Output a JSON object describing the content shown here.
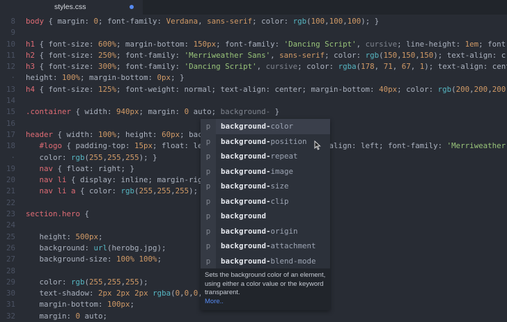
{
  "tab": {
    "title": "styles.css",
    "modified": true
  },
  "lines": [
    {
      "n": "8",
      "i": 0,
      "t": [
        [
          "s",
          "body"
        ],
        [
          "t",
          " { margin: "
        ],
        [
          "n",
          "0"
        ],
        [
          "t",
          "; font-family: "
        ],
        [
          "n",
          "Verdana"
        ],
        [
          "t",
          ", "
        ],
        [
          "n",
          "sans-serif"
        ],
        [
          "t",
          "; color: "
        ],
        [
          "f",
          "rgb"
        ],
        [
          "t",
          "("
        ],
        [
          "n",
          "100"
        ],
        [
          "t",
          ","
        ],
        [
          "n",
          "100"
        ],
        [
          "t",
          ","
        ],
        [
          "n",
          "100"
        ],
        [
          "t",
          "); }"
        ]
      ]
    },
    {
      "n": "9",
      "i": 0,
      "t": []
    },
    {
      "n": "10",
      "i": 0,
      "t": [
        [
          "s",
          "h1"
        ],
        [
          "t",
          " { font-size: "
        ],
        [
          "n",
          "600%"
        ],
        [
          "t",
          "; margin-bottom: "
        ],
        [
          "n",
          "150px"
        ],
        [
          "t",
          "; font-family: "
        ],
        [
          "g",
          "'Dancing Script'"
        ],
        [
          "t",
          ", "
        ],
        [
          "m",
          "cursive"
        ],
        [
          "t",
          "; line-height: "
        ],
        [
          "n",
          "1em"
        ],
        [
          "t",
          "; font-"
        ]
      ]
    },
    {
      "n": "11",
      "i": 0,
      "t": [
        [
          "s",
          "h2"
        ],
        [
          "t",
          " { font-size: "
        ],
        [
          "n",
          "250%"
        ],
        [
          "t",
          "; font-family: "
        ],
        [
          "g",
          "'Merriweather Sans'"
        ],
        [
          "t",
          ", "
        ],
        [
          "n",
          "sans-serif"
        ],
        [
          "t",
          "; color: "
        ],
        [
          "f",
          "rgb"
        ],
        [
          "t",
          "("
        ],
        [
          "n",
          "150"
        ],
        [
          "t",
          ","
        ],
        [
          "n",
          "150"
        ],
        [
          "t",
          ","
        ],
        [
          "n",
          "150"
        ],
        [
          "t",
          "); text-align: c"
        ]
      ]
    },
    {
      "n": "12",
      "i": 0,
      "t": [
        [
          "s",
          "h3"
        ],
        [
          "t",
          " { font-size: "
        ],
        [
          "n",
          "300%"
        ],
        [
          "t",
          "; font-family: "
        ],
        [
          "g",
          "'Dancing Script'"
        ],
        [
          "t",
          ", "
        ],
        [
          "m",
          "cursive"
        ],
        [
          "t",
          "; color: "
        ],
        [
          "f",
          "rgba"
        ],
        [
          "t",
          "("
        ],
        [
          "n",
          "178"
        ],
        [
          "t",
          ", "
        ],
        [
          "n",
          "71"
        ],
        [
          "t",
          ", "
        ],
        [
          "n",
          "67"
        ],
        [
          "t",
          ", "
        ],
        [
          "n",
          "1"
        ],
        [
          "t",
          "); text-align: cent"
        ]
      ]
    },
    {
      "n": "·",
      "i": 0,
      "t": [
        [
          "t",
          "height: "
        ],
        [
          "n",
          "100%"
        ],
        [
          "t",
          "; margin-bottom: "
        ],
        [
          "n",
          "0px"
        ],
        [
          "t",
          "; }"
        ]
      ]
    },
    {
      "n": "13",
      "i": 0,
      "t": [
        [
          "s",
          "h4"
        ],
        [
          "t",
          " { font-size: "
        ],
        [
          "n",
          "125%"
        ],
        [
          "t",
          "; font-weight: normal; text-align: center; margin-bottom: "
        ],
        [
          "n",
          "40px"
        ],
        [
          "t",
          "; color: "
        ],
        [
          "f",
          "rgb"
        ],
        [
          "t",
          "("
        ],
        [
          "n",
          "200"
        ],
        [
          "t",
          ","
        ],
        [
          "n",
          "200"
        ],
        [
          "t",
          ","
        ],
        [
          "n",
          "200"
        ]
      ]
    },
    {
      "n": "14",
      "i": 0,
      "t": []
    },
    {
      "n": "15",
      "i": 0,
      "t": [
        [
          "s",
          ".container"
        ],
        [
          "t",
          " { width: "
        ],
        [
          "n",
          "940px"
        ],
        [
          "t",
          "; margin: "
        ],
        [
          "n",
          "0"
        ],
        [
          "t",
          " auto; "
        ],
        [
          "m",
          "background-"
        ],
        [
          "t",
          " }"
        ]
      ]
    },
    {
      "n": "16",
      "i": 0,
      "t": []
    },
    {
      "n": "17",
      "i": 0,
      "t": [
        [
          "s",
          "header"
        ],
        [
          "t",
          " { width: "
        ],
        [
          "n",
          "100%"
        ],
        [
          "t",
          "; height: "
        ],
        [
          "n",
          "60px"
        ],
        [
          "t",
          "; bac"
        ]
      ]
    },
    {
      "n": "18",
      "i": 1,
      "t": [
        [
          "s",
          "#logo"
        ],
        [
          "t",
          " { padding-top: "
        ],
        [
          "n",
          "15px"
        ],
        [
          "t",
          "; float: le                            align: left; font-family: "
        ],
        [
          "g",
          "'Merriweather"
        ]
      ]
    },
    {
      "n": "·",
      "i": 1,
      "t": [
        [
          "t",
          "color: "
        ],
        [
          "f",
          "rgb"
        ],
        [
          "t",
          "("
        ],
        [
          "n",
          "255"
        ],
        [
          "t",
          ","
        ],
        [
          "n",
          "255"
        ],
        [
          "t",
          ","
        ],
        [
          "n",
          "255"
        ],
        [
          "t",
          "); }"
        ]
      ]
    },
    {
      "n": "19",
      "i": 1,
      "t": [
        [
          "s",
          "nav"
        ],
        [
          "t",
          " { float: right; }"
        ]
      ]
    },
    {
      "n": "20",
      "i": 1,
      "t": [
        [
          "s",
          "nav li"
        ],
        [
          "t",
          " { display: inline; margin-rig"
        ]
      ]
    },
    {
      "n": "21",
      "i": 1,
      "t": [
        [
          "s",
          "nav li a"
        ],
        [
          "t",
          " { color: "
        ],
        [
          "f",
          "rgb"
        ],
        [
          "t",
          "("
        ],
        [
          "n",
          "255"
        ],
        [
          "t",
          ","
        ],
        [
          "n",
          "255"
        ],
        [
          "t",
          ","
        ],
        [
          "n",
          "255"
        ],
        [
          "t",
          ");"
        ]
      ]
    },
    {
      "n": "22",
      "i": 0,
      "t": []
    },
    {
      "n": "23",
      "i": 0,
      "t": [
        [
          "s",
          "section.hero"
        ],
        [
          "t",
          " {"
        ]
      ]
    },
    {
      "n": "24",
      "i": 0,
      "t": []
    },
    {
      "n": "25",
      "i": 1,
      "t": [
        [
          "t",
          "height: "
        ],
        [
          "n",
          "500px"
        ],
        [
          "t",
          ";"
        ]
      ]
    },
    {
      "n": "26",
      "i": 1,
      "t": [
        [
          "t",
          "background: "
        ],
        [
          "f",
          "url"
        ],
        [
          "t",
          "(herobg.jpg);"
        ]
      ]
    },
    {
      "n": "27",
      "i": 1,
      "t": [
        [
          "t",
          "background-size: "
        ],
        [
          "n",
          "100%"
        ],
        [
          "t",
          " "
        ],
        [
          "n",
          "100%"
        ],
        [
          "t",
          ";"
        ]
      ]
    },
    {
      "n": "28",
      "i": 0,
      "t": []
    },
    {
      "n": "29",
      "i": 1,
      "t": [
        [
          "t",
          "color: "
        ],
        [
          "f",
          "rgb"
        ],
        [
          "t",
          "("
        ],
        [
          "n",
          "255"
        ],
        [
          "t",
          ","
        ],
        [
          "n",
          "255"
        ],
        [
          "t",
          ","
        ],
        [
          "n",
          "255"
        ],
        [
          "t",
          ");"
        ]
      ]
    },
    {
      "n": "30",
      "i": 1,
      "t": [
        [
          "t",
          "text-shadow: "
        ],
        [
          "n",
          "2px"
        ],
        [
          "t",
          " "
        ],
        [
          "n",
          "2px"
        ],
        [
          "t",
          " "
        ],
        [
          "n",
          "2px"
        ],
        [
          "t",
          " "
        ],
        [
          "f",
          "rgba"
        ],
        [
          "t",
          "("
        ],
        [
          "n",
          "0"
        ],
        [
          "t",
          ","
        ],
        [
          "n",
          "0"
        ],
        [
          "t",
          ","
        ],
        [
          "n",
          "0"
        ],
        [
          "t",
          ","
        ]
      ]
    },
    {
      "n": "31",
      "i": 1,
      "t": [
        [
          "t",
          "margin-bottom: "
        ],
        [
          "n",
          "100px"
        ],
        [
          "t",
          ";"
        ]
      ]
    },
    {
      "n": "32",
      "i": 1,
      "t": [
        [
          "t",
          "margin: "
        ],
        [
          "n",
          "0"
        ],
        [
          "t",
          " auto;"
        ]
      ]
    }
  ],
  "autocomplete": {
    "prefix": "background",
    "kind": "p",
    "items": [
      {
        "bold": "background-",
        "rest": "color"
      },
      {
        "bold": "background-",
        "rest": "position"
      },
      {
        "bold": "background-",
        "rest": "repeat"
      },
      {
        "bold": "background-",
        "rest": "image"
      },
      {
        "bold": "background-",
        "rest": "size"
      },
      {
        "bold": "background-",
        "rest": "clip"
      },
      {
        "bold": "background",
        "rest": ""
      },
      {
        "bold": "background-",
        "rest": "origin"
      },
      {
        "bold": "background-",
        "rest": "attachment"
      },
      {
        "bold": "background-",
        "rest": "blend-mode"
      }
    ],
    "description": "Sets the background color of an element, using either a color value or the keyword transparent.",
    "more_label": "More.."
  }
}
